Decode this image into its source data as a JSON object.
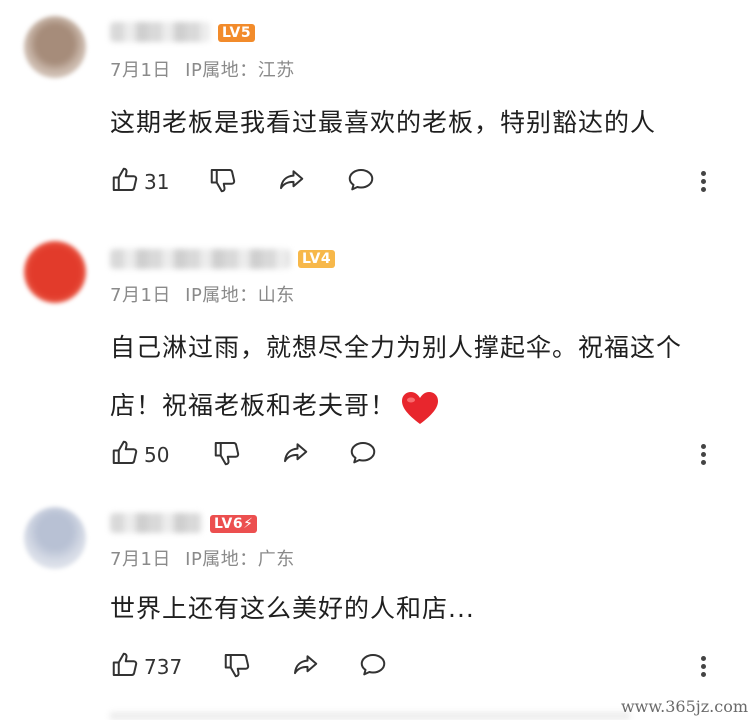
{
  "comments": [
    {
      "level": "LV5",
      "level_color": "#f28b2b",
      "date": "7月1日",
      "ip_label": "IP属地：江苏",
      "text": "这期老板是我看过最喜欢的老板，特别豁达的人",
      "likes": "31"
    },
    {
      "level": "LV4",
      "level_color": "#f7b84a",
      "date": "7月1日",
      "ip_label": "IP属地：山东",
      "text": "自己淋过雨，就想尽全力为别人撑起伞。祝福这个店！祝福老板和老夫哥！",
      "likes": "50"
    },
    {
      "level": "LV6⚡",
      "level_color": "#ec4f4f",
      "date": "7月1日",
      "ip_label": "IP属地：广东",
      "text": "世界上还有这么美好的人和店...",
      "likes": "737"
    }
  ],
  "icons": {
    "like": "thumbs-up-icon",
    "dislike": "thumbs-down-icon",
    "share": "share-icon",
    "reply": "comment-icon",
    "more": "more-vertical-icon",
    "heart": "heart-emoji-icon"
  },
  "watermark": "www.365jz.com"
}
